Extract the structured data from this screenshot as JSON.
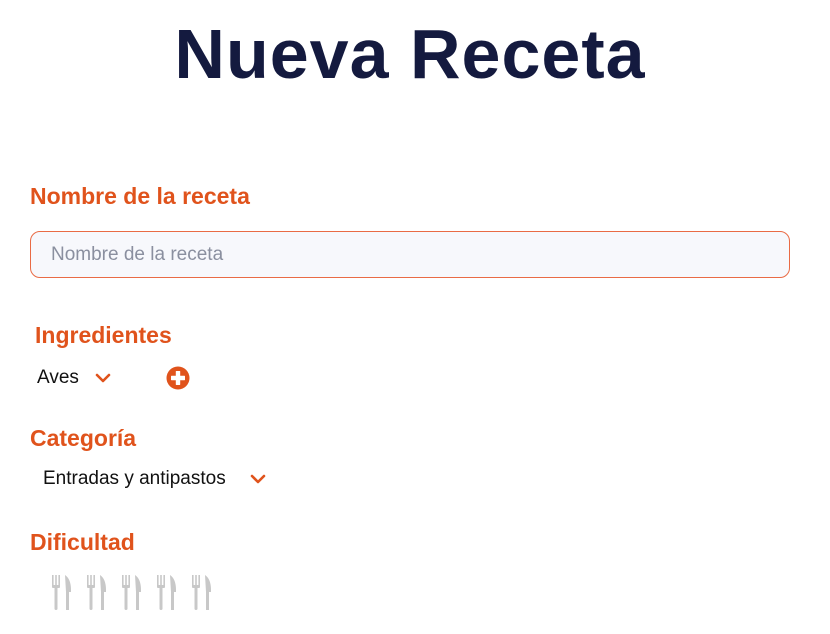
{
  "page": {
    "title": "Nueva Receta"
  },
  "recipe_name": {
    "label": "Nombre de la receta",
    "placeholder": "Nombre de la receta",
    "value": ""
  },
  "ingredients": {
    "label": "Ingredientes",
    "selected": "Aves",
    "add_icon": "plus-circle-icon"
  },
  "category": {
    "label": "Categoría",
    "selected": "Entradas y antipastos"
  },
  "difficulty": {
    "label": "Dificultad",
    "icon": "fork-knife-icon",
    "max": 5,
    "value": 0
  },
  "colors": {
    "title": "#141a3f",
    "accent": "#e0531c",
    "input_border": "#e96b45",
    "input_bg": "#f7f8fc",
    "icon_inactive": "#c8c8c8"
  }
}
